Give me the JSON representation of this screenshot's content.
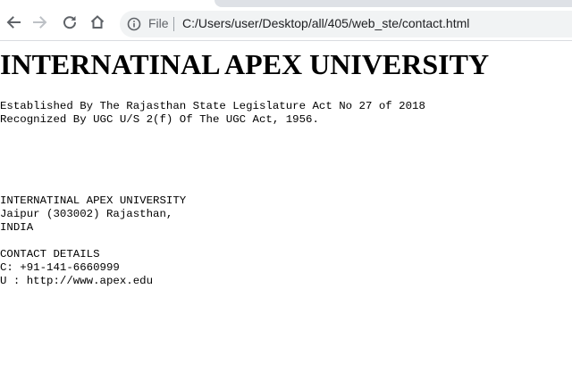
{
  "browser": {
    "scheme_label": "File",
    "url": "C:/Users/user/Desktop/all/405/web_ste/contact.html",
    "icons": {
      "back": "back-arrow-icon",
      "forward": "forward-arrow-icon",
      "reload": "reload-icon",
      "home": "home-icon",
      "info": "info-icon"
    }
  },
  "page": {
    "heading": "INTERNATINAL APEX UNIVERSITY",
    "established_line": "Established By The Rajasthan State Legislature Act No 27 of 2018",
    "recognized_line": "Recognized By UGC U/S 2(f) Of The UGC Act, 1956.",
    "address": {
      "name": "INTERNATINAL APEX UNIVERSITY",
      "city": "Jaipur (303002) Rajasthan,",
      "country": "INDIA"
    },
    "contact": {
      "title": "CONTACT DETAILS",
      "phone": "C: +91-141-6660999",
      "url": "U : http://www.apex.edu"
    }
  }
}
